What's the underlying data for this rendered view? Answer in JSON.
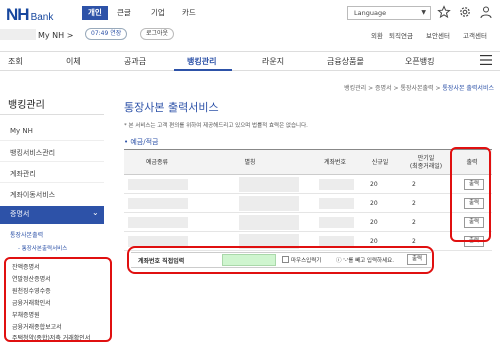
{
  "brand": {
    "nh": "NH",
    "bank": "Bank"
  },
  "top_tabs": [
    "개인",
    "큰글",
    "기업",
    "카드"
  ],
  "language": {
    "value": "Language"
  },
  "user": {
    "name": "My NH >",
    "timer": "07:49 연장",
    "logout": "로그아웃"
  },
  "util_links": [
    "외환",
    "퇴직연금",
    "보안센터",
    "고객센터"
  ],
  "gnb": [
    "조회",
    "이체",
    "공과금",
    "뱅킹관리",
    "라운지",
    "금융상품몰",
    "오픈뱅킹"
  ],
  "breadcrumb": [
    "뱅킹관리",
    "증명서",
    "통장사본출력",
    "통장사본 출력서비스"
  ],
  "lnb": {
    "title": "뱅킹관리",
    "items": [
      "My NH",
      "뱅킹서비스관리",
      "계좌관리",
      "계좌이동서비스"
    ],
    "active": "증명서",
    "sub_active": "통장사본출력",
    "sub_active_child": "- 통장사본출력서비스",
    "sub_items": [
      "잔액증명서",
      "연말정산증명서",
      "원천징수영수증",
      "금융거래확인서",
      "부채증명원",
      "금융거래종합보고서",
      "주택청약(종합)저축 거래확인서"
    ]
  },
  "main": {
    "title": "통장사본 출력서비스",
    "notice": "* 본 서비스는 고객 편의를 위하여 제공해드리고 있으며 법률적 효력은 없습니다.",
    "section": "• 예금/적금"
  },
  "table": {
    "headers": [
      "예금종류",
      "별칭",
      "계좌번호",
      "신규일",
      "만기일\n(최종거래일)",
      "출력"
    ],
    "rows": [
      {
        "new_date": "20",
        "maturity": "2",
        "action": "출력"
      },
      {
        "new_date": "20",
        "maturity": "2",
        "action": "출력"
      },
      {
        "new_date": "20",
        "maturity": "2",
        "action": "출력"
      },
      {
        "new_date": "20",
        "maturity": "2",
        "action": "출력"
      }
    ]
  },
  "direct": {
    "label": "계좌번호 직접입력",
    "mask_label": "마우스입력기",
    "hint": "'-'를 빼고 입력하세요.",
    "button": "출력"
  },
  "colors": {
    "primary": "#2d52a8",
    "highlight": "#e01010",
    "input_bg": "#cff5cf"
  }
}
